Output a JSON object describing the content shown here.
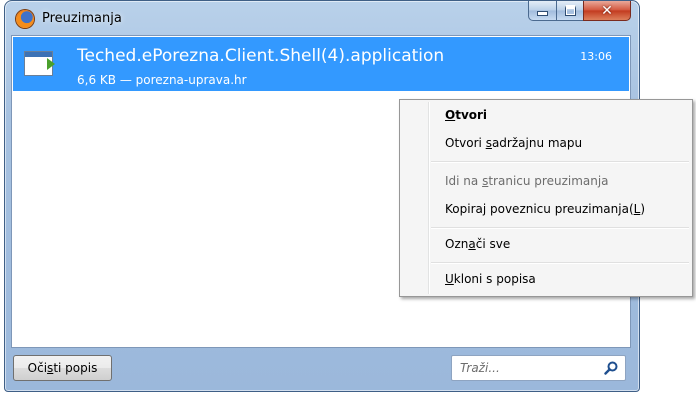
{
  "window": {
    "title": "Preuzimanja",
    "icon": "firefox-icon",
    "caption_buttons": [
      "minimize-icon",
      "maximize-icon",
      "close-icon"
    ]
  },
  "downloads": [
    {
      "name": "Teched.ePorezna.Client.Shell(4).application",
      "info": "6,6 KB — porezna-uprava.hr",
      "time": "13:06",
      "icon": "application-file-icon",
      "selected": true
    }
  ],
  "bottombar": {
    "clear_button": {
      "pre": "Oči",
      "key": "s",
      "post": "ti popis"
    },
    "search_placeholder": "Traži..."
  },
  "context_menu": {
    "items": [
      {
        "pre": "",
        "key": "O",
        "post": "tvori",
        "bold": true
      },
      {
        "pre": "Otvori ",
        "key": "s",
        "post": "adržajnu mapu"
      },
      {
        "pre": "Idi na ",
        "key": "s",
        "post": "tranicu preuzimanja",
        "disabled": true
      },
      {
        "pre": "Kopiraj poveznicu preuzimanja(",
        "key": "L",
        "post": ")"
      },
      {
        "pre": "Ozn",
        "key": "a",
        "post": "či sve"
      },
      {
        "pre": "",
        "key": "U",
        "post": "kloni s popisa"
      }
    ]
  },
  "colors": {
    "selection": "#3399ff",
    "menu_bg": "#f5f5f5",
    "frame": "#a6c1e0"
  }
}
